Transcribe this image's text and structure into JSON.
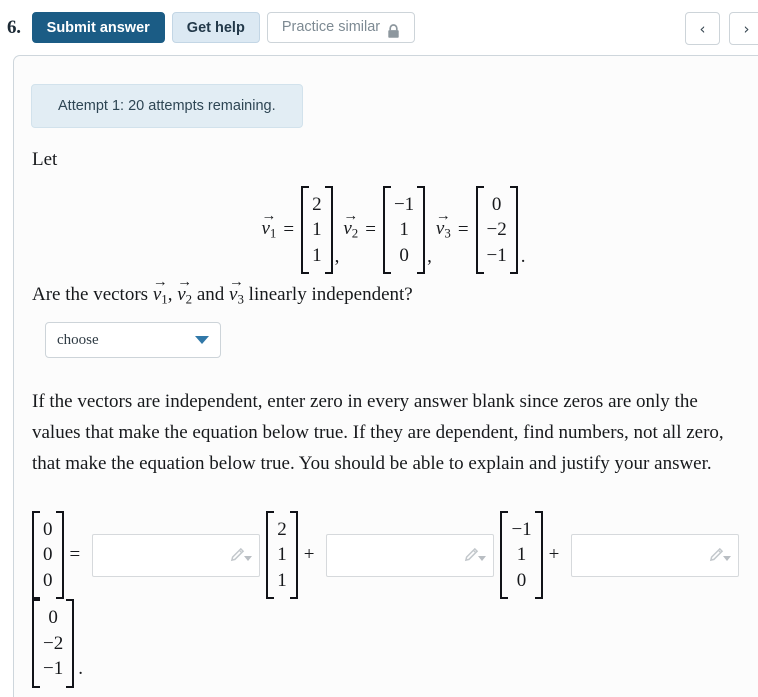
{
  "toolbar": {
    "question_number": "6.",
    "submit_label": "Submit answer",
    "get_help_label": "Get help",
    "practice_label": "Practice similar",
    "practice_icon": "lock-icon",
    "prev_icon": "chevron-left-icon",
    "prev_glyph": "‹",
    "next_icon": "chevron-right-icon",
    "next_glyph": "›"
  },
  "colors": {
    "submit_bg": "#1b5c85",
    "get_help_bg": "#dce9f3",
    "banner_bg": "#e2edf4",
    "caret_blue": "#3178a8",
    "card_bg": "#fcfcfc"
  },
  "card": {
    "attempt_banner": "Attempt 1: 20 attempts remaining.",
    "let_text": "Let",
    "question_text_prefix": "Are the vectors ",
    "question_text_middle": " and ",
    "question_text_suffix": " linearly independent?",
    "paragraph": "If the vectors are independent, enter zero in every answer blank since zeros are only the values that make the equation below true. If they are dependent, find numbers, not all zero, that make the equation below true. You should be able to explain and justify your answer."
  },
  "vectors": {
    "v1": {
      "name": "v",
      "index": "1",
      "entries": [
        "2",
        "1",
        "1"
      ]
    },
    "v2": {
      "name": "v",
      "index": "2",
      "entries": [
        "−1",
        "1",
        "0"
      ]
    },
    "v3": {
      "name": "v",
      "index": "3",
      "entries": [
        "0",
        "−2",
        "−1"
      ]
    },
    "arrow": "→",
    "equals": "=",
    "comma": ",",
    "period": "."
  },
  "dropdown": {
    "selected": "choose",
    "caret_icon": "caret-down-icon"
  },
  "answer_equation": {
    "zero_vector": [
      "0",
      "0",
      "0"
    ],
    "equals": "=",
    "plus": "+",
    "period": ".",
    "blank1": {
      "value": "",
      "icon": "pencil-icon"
    },
    "blank2": {
      "value": "",
      "icon": "pencil-icon"
    },
    "blank3": {
      "value": "",
      "icon": "pencil-icon"
    },
    "coef1_vector": [
      "2",
      "1",
      "1"
    ],
    "coef2_vector": [
      "−1",
      "1",
      "0"
    ],
    "coef3_vector": [
      "0",
      "−2",
      "−1"
    ]
  }
}
